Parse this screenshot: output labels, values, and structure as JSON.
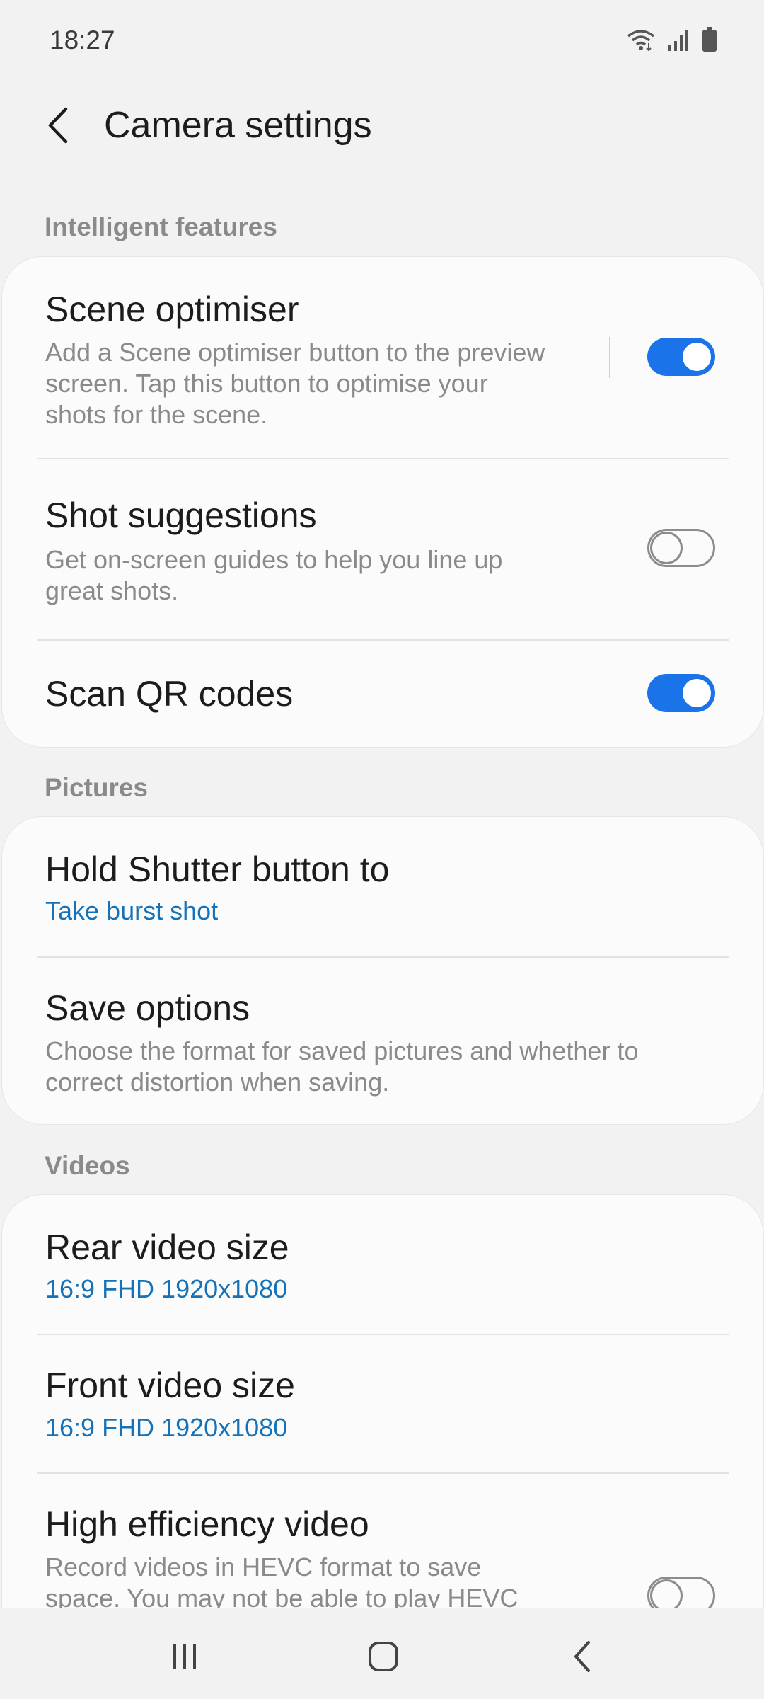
{
  "status_bar": {
    "time": "18:27",
    "icons": [
      "wifi-icon",
      "signal-icon",
      "battery-icon"
    ]
  },
  "header": {
    "back_icon": "chevron-left-icon",
    "title": "Camera settings"
  },
  "sections": {
    "intelligent": {
      "label": "Intelligent features",
      "scene_optimiser": {
        "title": "Scene optimiser",
        "desc_lines": [
          "Add a Scene optimiser button to the preview",
          "screen. Tap this button to optimise your",
          "shots for the scene."
        ],
        "toggle": "on"
      },
      "shot_suggestions": {
        "title": "Shot suggestions",
        "desc_lines": [
          "Get on-screen guides to help you line up",
          "great shots."
        ],
        "toggle": "off"
      },
      "scan_qr": {
        "title": "Scan QR codes",
        "toggle": "on"
      }
    },
    "pictures": {
      "label": "Pictures",
      "hold_shutter": {
        "title": "Hold Shutter button to",
        "value": "Take burst shot"
      },
      "save_options": {
        "title": "Save options",
        "desc_lines": [
          "Choose the format for saved pictures and whether to",
          "correct distortion when saving."
        ]
      }
    },
    "videos": {
      "label": "Videos",
      "rear_size": {
        "title": "Rear video size",
        "value": "16:9 FHD 1920x1080"
      },
      "front_size": {
        "title": "Front video size",
        "value": "16:9 FHD 1920x1080"
      },
      "hevc": {
        "title": "High efficiency video",
        "desc_lines": [
          "Record videos in HEVC format to save",
          "space. You may not be able to play HEVC"
        ],
        "toggle": "off"
      }
    }
  },
  "nav_bar": {
    "icons": [
      "recent-apps-icon",
      "home-icon",
      "back-icon"
    ]
  },
  "colors": {
    "accent": "#1a73e8",
    "value_text": "#1672b8",
    "background": "#f2f2f2",
    "card": "#fbfbfb"
  }
}
